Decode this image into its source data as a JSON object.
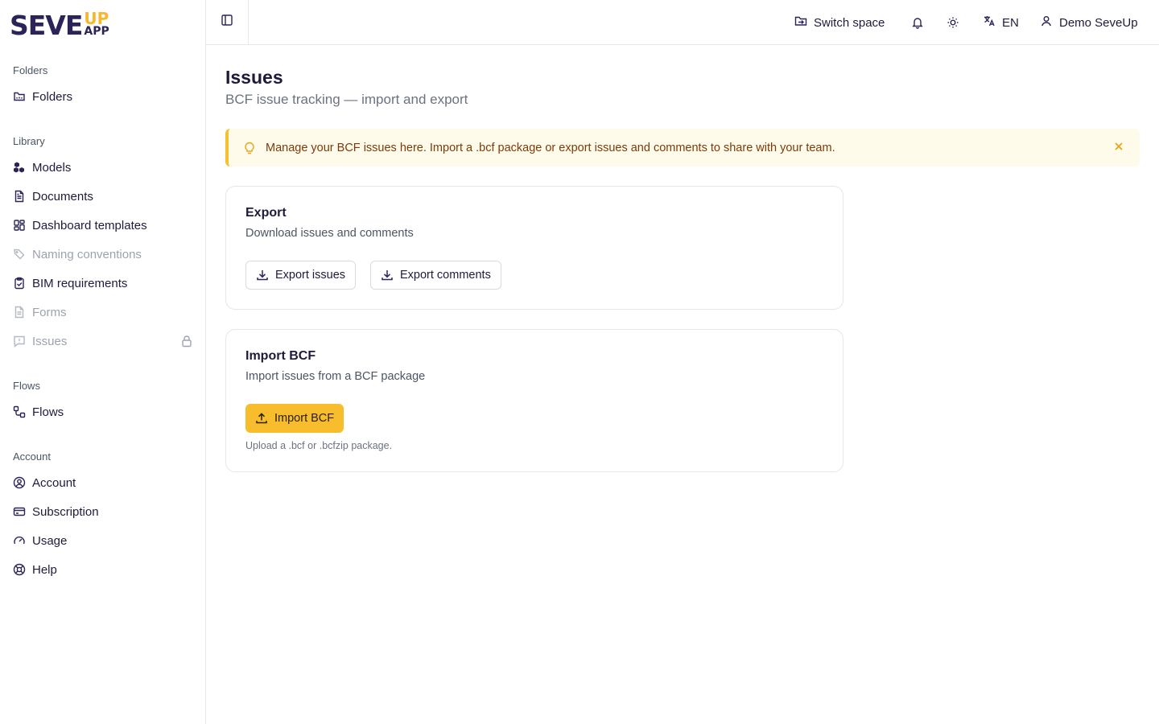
{
  "brand": {
    "main": "SEVE",
    "up": "UP",
    "app": "APP"
  },
  "sidebar": {
    "sections": [
      {
        "label": "Folders"
      },
      {
        "label": "Library"
      },
      {
        "label": "Flows"
      },
      {
        "label": "Account"
      }
    ],
    "items": [
      {
        "label": "Folders",
        "icon": "folder-icon"
      },
      {
        "label": "Models",
        "icon": "boxes-icon"
      },
      {
        "label": "Documents",
        "icon": "document-icon"
      },
      {
        "label": "Dashboard templates",
        "icon": "layout-dashboard-icon"
      },
      {
        "label": "Naming conventions",
        "icon": "tags-icon",
        "disabled": true
      },
      {
        "label": "BIM requirements",
        "icon": "clipboard-check-icon"
      },
      {
        "label": "Forms",
        "icon": "file-text-icon",
        "disabled": true
      },
      {
        "label": "Issues",
        "icon": "message-alert-icon",
        "disabled": true,
        "locked": true
      },
      {
        "label": "Flows",
        "icon": "workflow-icon"
      },
      {
        "label": "Account",
        "icon": "user-circle-icon"
      },
      {
        "label": "Subscription",
        "icon": "credit-card-icon"
      },
      {
        "label": "Usage",
        "icon": "gauge-icon"
      },
      {
        "label": "Help",
        "icon": "life-buoy-icon"
      }
    ]
  },
  "header": {
    "switch_space": "Switch space",
    "language": "EN",
    "user": "Demo SeveUp"
  },
  "page": {
    "title": "Issues",
    "subtitle": "BCF issue tracking — import and export"
  },
  "alert": {
    "message": "Manage your BCF issues here. Import a .bcf package or export issues and comments to share with your team."
  },
  "export_card": {
    "title": "Export",
    "description": "Download issues and comments",
    "export_issues_label": "Export issues",
    "export_comments_label": "Export comments"
  },
  "import_card": {
    "title": "Import BCF",
    "description": "Import issues from a BCF package",
    "import_label": "Import BCF",
    "hint": "Upload a .bcf or .bcfzip package."
  },
  "colors": {
    "brand_primary": "#2a2458",
    "brand_accent": "#f5b82e",
    "alert_bg": "#fffbea",
    "button_primary": "#f8bd2d"
  }
}
